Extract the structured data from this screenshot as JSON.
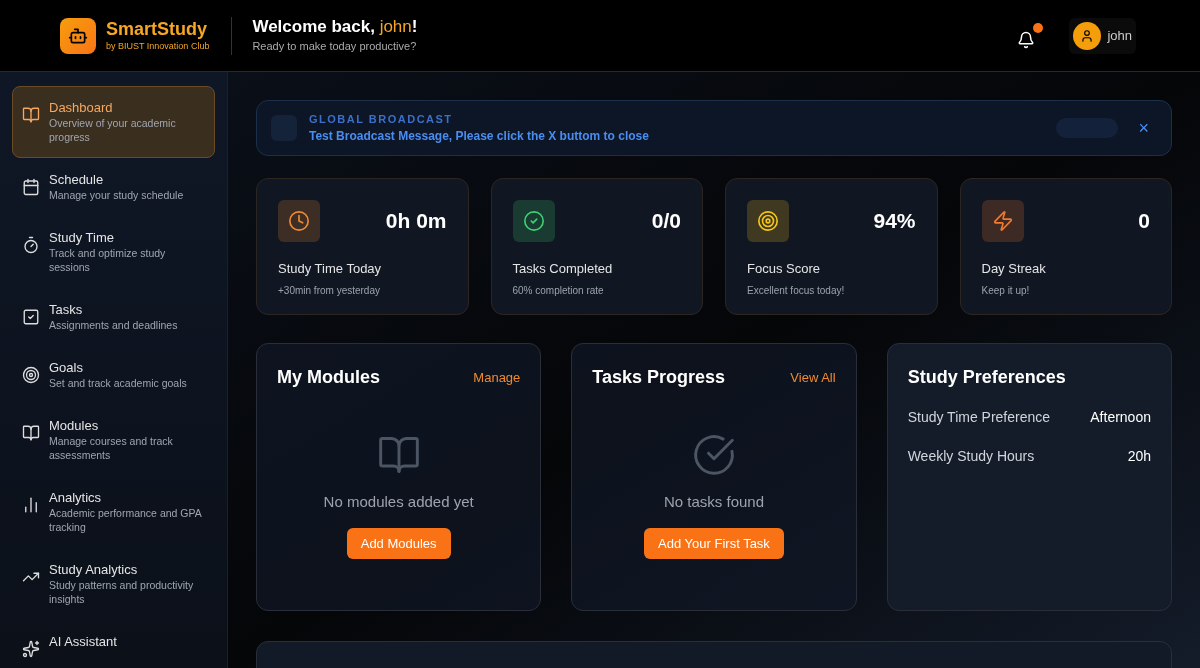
{
  "header": {
    "brand": "SmartStudy",
    "tagline": "by BIUST Innovation Club",
    "welcome_prefix": "Welcome back, ",
    "user_name": "john",
    "welcome_suffix": "!",
    "subtitle": "Ready to make today productive?",
    "notification_dot": true,
    "account": "john"
  },
  "sidebar": {
    "items": [
      {
        "label": "Dashboard",
        "description": "Overview of your academic progress",
        "selected": true
      },
      {
        "label": "Schedule",
        "description": "Manage your study schedule",
        "selected": false
      },
      {
        "label": "Study Time",
        "description": "Track and optimize study sessions",
        "selected": false
      },
      {
        "label": "Tasks",
        "description": "Assignments and deadlines",
        "selected": false
      },
      {
        "label": "Goals",
        "description": "Set and track academic goals",
        "selected": false
      },
      {
        "label": "Modules",
        "description": "Manage courses and track assessments",
        "selected": false
      },
      {
        "label": "Analytics",
        "description": "Academic performance and GPA tracking",
        "selected": false
      },
      {
        "label": "Study Analytics",
        "description": "Study patterns and productivity insights",
        "selected": false
      },
      {
        "label": "AI Assistant",
        "selected": false
      }
    ]
  },
  "broadcast": {
    "heading": "GLOBAL BROADCAST",
    "message": "Test Broadcast Message, Please click the X buttom to close",
    "close": "×"
  },
  "stats": [
    {
      "value": "0h 0m",
      "label": "Study Time Today",
      "note": "+30min from yesterday",
      "color": "#f08a30"
    },
    {
      "value": "0/0",
      "label": "Tasks Completed",
      "note": "60% completion rate",
      "color": "#3ecf72"
    },
    {
      "value": "94%",
      "label": "Focus Score",
      "note": "Excellent focus today!",
      "color": "#f5c518"
    },
    {
      "value": "0",
      "label": "Day Streak",
      "note": "Keep it up!",
      "color": "#f07a30"
    }
  ],
  "modules": {
    "title": "My Modules",
    "link": "Manage",
    "empty": "No modules added yet",
    "button": "Add Modules"
  },
  "tasks_progress": {
    "title": "Tasks Progress",
    "link": "View All",
    "empty": "No tasks found",
    "button": "Add Your First Task"
  },
  "preferences": {
    "title": "Study Preferences",
    "rows": [
      {
        "label": "Study Time Preference",
        "value": "Afternoon"
      },
      {
        "label": "Weekly Study Hours",
        "value": "20h"
      }
    ]
  }
}
